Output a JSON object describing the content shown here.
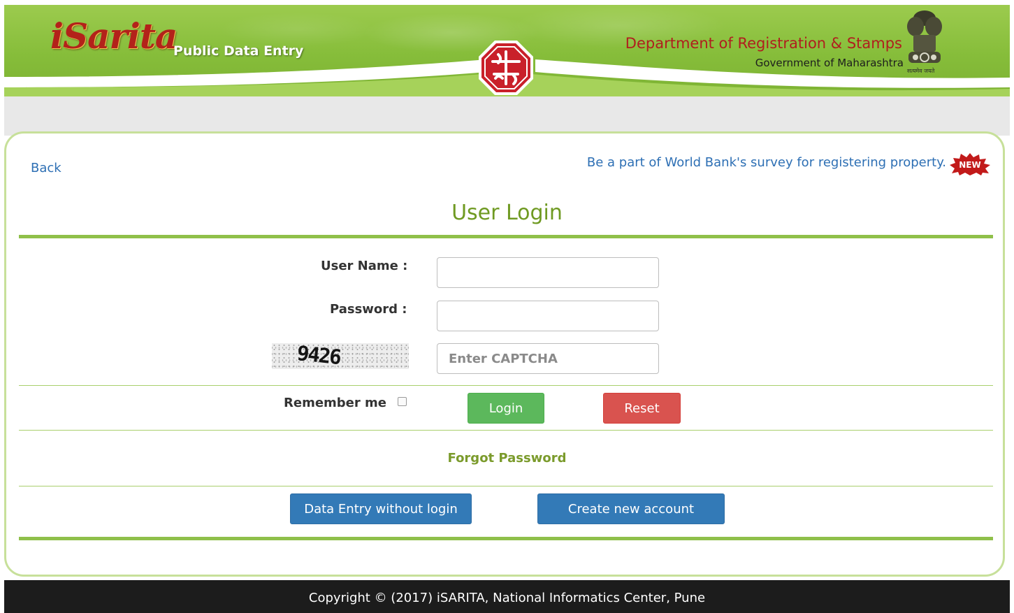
{
  "header": {
    "logo_text": "iSarita",
    "subtitle": "Public Data Entry",
    "department": "Department of Registration & Stamps",
    "government": "Government of Maharashtra",
    "emblem_caption": "सत्यमेव जयते"
  },
  "nav": {
    "back_label": "Back",
    "survey_link": "Be a part of World Bank's survey for registering property.",
    "new_badge": "NEW"
  },
  "login": {
    "title": "User Login",
    "username_label": "User Name :",
    "username_value": "",
    "password_label": "Password :",
    "password_value": "",
    "captcha_text": "9426",
    "captcha_placeholder": "Enter CAPTCHA",
    "remember_label": "Remember me",
    "remember_checked": false,
    "login_label": "Login",
    "reset_label": "Reset",
    "forgot_label": "Forgot Password",
    "data_entry_label": "Data Entry without login",
    "create_account_label": "Create new account"
  },
  "footer": {
    "copyright": "Copyright © (2017) iSARITA, National Informatics Center, Pune"
  },
  "colors": {
    "header_green": "#86bd3a",
    "accent_green": "#8fc04a",
    "title_green": "#6f9a22",
    "link_blue": "#2d6fb4",
    "login_green": "#5cb85c",
    "reset_red": "#d9534f",
    "primary_blue": "#337ab7",
    "footer_dark": "#1c1c1c"
  },
  "icons": [
    "isarita-logo",
    "center-seal-icon",
    "national-emblem-icon",
    "new-badge-icon",
    "checkbox-icon"
  ]
}
